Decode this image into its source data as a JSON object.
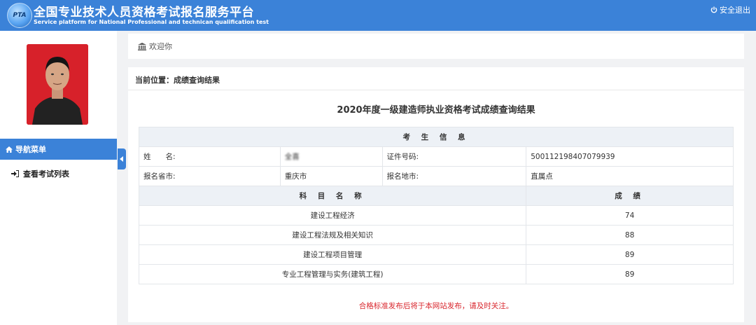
{
  "header": {
    "title_cn": "全国专业技术人员资格考试报名服务平台",
    "title_en": "Service platform for National Professional and technican qualification test",
    "logo_text": "PTA",
    "logout_label": "安全退出"
  },
  "sidebar": {
    "nav_header": "导航菜单",
    "items": [
      {
        "label": "查看考试列表"
      }
    ]
  },
  "welcome": "欢迎你",
  "breadcrumb": "当前位置：成绩查询结果",
  "result_title": "2020年度一级建造师执业资格考试成绩查询结果",
  "candidate": {
    "section_title": "考 生 信 息",
    "name_label": "姓　　名:",
    "name_value": "全喜",
    "id_label": "证件号码:",
    "id_value": "500112198407079939",
    "province_label": "报名省市:",
    "province_value": "重庆市",
    "site_label": "报名地市:",
    "site_value": "直属点"
  },
  "scores": {
    "subject_header": "科 目 名 称",
    "score_header": "成 绩",
    "rows": [
      {
        "subject": "建设工程经济",
        "score": "74"
      },
      {
        "subject": "建设工程法规及相关知识",
        "score": "88"
      },
      {
        "subject": "建设工程项目管理",
        "score": "89"
      },
      {
        "subject": "专业工程管理与实务(建筑工程)",
        "score": "89"
      }
    ]
  },
  "notice": "合格标准发布后将于本网站发布，请及时关注。",
  "colors": {
    "brand": "#3b82d8",
    "notice": "#d9272e",
    "photo_bg": "#d7212a"
  }
}
